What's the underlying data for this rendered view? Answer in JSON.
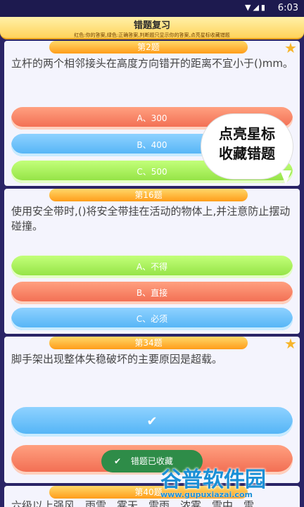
{
  "status_bar": {
    "time": "6:03",
    "icons": [
      "wifi-icon",
      "signal-icon",
      "battery-icon"
    ]
  },
  "header": {
    "title": "错题复习",
    "subtitle": "红色:你的答案,绿色:正确答案,判断题只显示你的答案,点亮星标收藏错题"
  },
  "questions": [
    {
      "number": "第2题",
      "text": "立杆的两个相邻接头在高度方向错开的距离不宜小于()mm。",
      "options": [
        "A、300",
        "B、400",
        "C、500"
      ]
    },
    {
      "number": "第16题",
      "text": "使用安全带时,()将安全带挂在活动的物体上,并注意防止摆动碰撞。",
      "options": [
        "A、不得",
        "B、直接",
        "C、必须"
      ]
    },
    {
      "number": "第34题",
      "text": "脚手架出现整体失稳破坏的主要原因是超载。",
      "options": [
        "✔",
        ""
      ]
    },
    {
      "number": "第40题",
      "text": "六级以上强风、雨雪、雾天、雷雨、浓雾、雪中、雷"
    }
  ],
  "bubble": {
    "line1": "点亮星标",
    "line2": "收藏错题"
  },
  "toast": {
    "icon": "✔",
    "text": "错题已收藏"
  },
  "watermark": {
    "main": "谷普软件园",
    "sub": "www.gupuxiazai.com"
  },
  "colors": {
    "wrong": "#f16a4f",
    "correct": "#8fe040",
    "neutral": "#4fb2f5",
    "star": "#f7b52a"
  }
}
